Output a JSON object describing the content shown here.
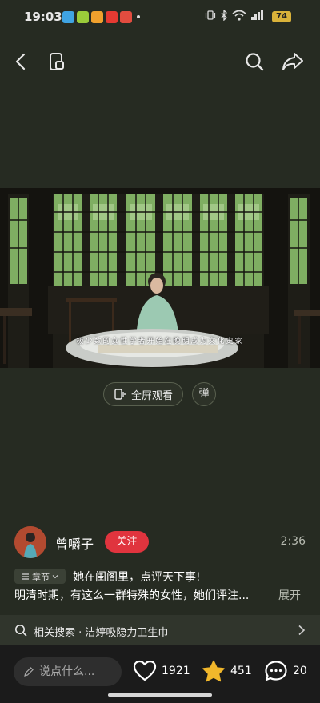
{
  "status_bar": {
    "time": "19:03",
    "battery": "74",
    "notification_colors": [
      "#3fa4e3",
      "#9acb3a",
      "#f0a12d",
      "#e63a32",
      "#e24c3f"
    ]
  },
  "topbar": {
    "icons": [
      "back-icon",
      "pip-icon",
      "search-icon",
      "share-icon"
    ]
  },
  "video": {
    "subtitle": "极少数的女性学者开始在晚明成为文化史家"
  },
  "controls": {
    "fullscreen_label": "全屏观看",
    "danmaku_label": "弹"
  },
  "author": {
    "name": "曾嚼子",
    "follow_label": "关注",
    "duration": "2:36"
  },
  "description": {
    "chapter_label": "章节",
    "title": "她在闺阁里，点评天下事!",
    "body": "明清时期，有这么一群特殊的女性，她们评注...",
    "expand_label": "展开"
  },
  "related_search": {
    "text": "相关搜索 · 洁婷吸隐力卫生巾"
  },
  "bottom_bar": {
    "comment_placeholder": "说点什么...",
    "likes": "1921",
    "favorites": "451",
    "comments": "20"
  },
  "colors": {
    "background": "#262b22",
    "follow": "#e0343e",
    "star": "#f1b72b"
  }
}
